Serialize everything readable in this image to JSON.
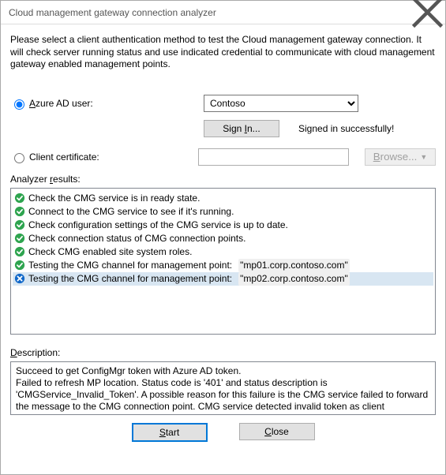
{
  "window": {
    "title": "Cloud management gateway connection analyzer"
  },
  "instructions": "Please select a client authentication method to test the Cloud management gateway connection. It will check server running status and use indicated credential to communicate with cloud management gateway enabled management points.",
  "auth": {
    "azure_label_pre": "",
    "azure_label": "Azure AD user:",
    "azure_label_u": "A",
    "azure_label_rest": "zure AD user:",
    "dropdown_value": "Contoso",
    "signin_label": "Sign In...",
    "signin_u": "I",
    "signin_pre": "Sign ",
    "signin_post": "n...",
    "signed_in_status": "Signed in successfully!",
    "cert_label": "Client certificate:",
    "cert_value": "",
    "browse_label": "Browse...",
    "browse_u": "B",
    "browse_rest": "rowse..."
  },
  "results": {
    "label": "Analyzer results:",
    "label_u": "r",
    "label_pre": "Analyzer ",
    "label_post": "esults:",
    "items": [
      {
        "status": "ok",
        "text": "Check the CMG service is in ready state."
      },
      {
        "status": "ok",
        "text": "Connect to the CMG service to see if it's running."
      },
      {
        "status": "ok",
        "text": "Check configuration settings of the CMG service is up to date."
      },
      {
        "status": "ok",
        "text": "Check connection status of CMG connection points."
      },
      {
        "status": "ok",
        "text": "Check CMG enabled site system roles."
      },
      {
        "status": "ok",
        "text": "Testing the CMG channel for management point:",
        "host": "\"mp01.corp.contoso.com\""
      },
      {
        "status": "fail",
        "text": "Testing the CMG channel for management point:",
        "host": "\"mp02.corp.contoso.com\"",
        "selected": true
      }
    ]
  },
  "description": {
    "label": "Description:",
    "label_u": "D",
    "label_rest": "escription:",
    "text": "Succeed to get ConfigMgr token with Azure AD token.\nFailed to refresh MP location. Status code is '401' and status description is 'CMGService_Invalid_Token'. A possible reason for this failure is the CMG service failed to forward the message to the CMG connection point. CMG service detected invalid token as client credential."
  },
  "buttons": {
    "start": "Start",
    "start_u": "S",
    "start_rest": "tart",
    "close": "Close",
    "close_u": "C",
    "close_rest": "lose"
  }
}
